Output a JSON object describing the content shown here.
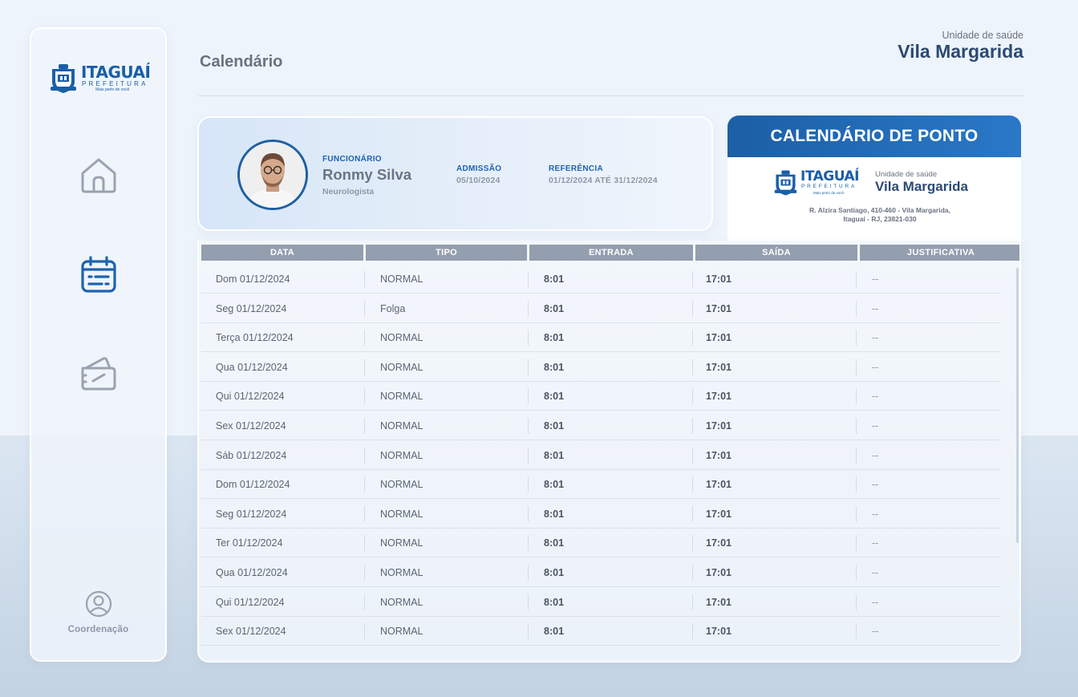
{
  "sidebar": {
    "logo": {
      "brand": "ITAGUAÍ",
      "subtitle": "PREFEITURA",
      "tagline": "Mais perto de você"
    },
    "items": [
      {
        "name": "home",
        "icon": "home-icon"
      },
      {
        "name": "calendar",
        "icon": "calendar-icon",
        "active": true
      },
      {
        "name": "ticket",
        "icon": "ticket-icon"
      }
    ],
    "user_label": "Coordenação"
  },
  "header": {
    "title": "Calendário",
    "unit_label": "Unidade de saúde",
    "unit_name": "Vila Margarida"
  },
  "employee": {
    "label": "FUNCIONÁRIO",
    "name": "Ronmy Silva",
    "role": "Neurologista",
    "admission_label": "ADMISSÃO",
    "admission": "05/10/2024",
    "reference_label": "REFERÊNCIA",
    "reference": "01/12/2024 ATÉ 31/12/2024"
  },
  "ponto_card": {
    "title": "CALENDÁRIO DE PONTO",
    "logo_brand": "ITAGUAÍ",
    "logo_subtitle": "PREFEITURA",
    "logo_tagline": "Mais perto de você",
    "unit_label": "Unidade de saúde",
    "unit_name": "Vila Margarida",
    "address_line1": "R. Alzira Santiago, 410-460 - Vila Margarida,",
    "address_line2": "Itaguaí - RJ, 23821-030"
  },
  "table": {
    "columns": [
      "DATA",
      "TIPO",
      "ENTRADA",
      "SAÍDA",
      "JUSTIFICATIVA"
    ],
    "rows": [
      {
        "data": "Dom 01/12/2024",
        "tipo": "NORMAL",
        "entrada": "8:01",
        "saida": "17:01",
        "justificativa": "--"
      },
      {
        "data": "Seg 01/12/2024",
        "tipo": "Folga",
        "entrada": "8:01",
        "saida": "17:01",
        "justificativa": "--"
      },
      {
        "data": "Terça 01/12/2024",
        "tipo": "NORMAL",
        "entrada": "8:01",
        "saida": "17:01",
        "justificativa": "--"
      },
      {
        "data": "Qua 01/12/2024",
        "tipo": "NORMAL",
        "entrada": "8:01",
        "saida": "17:01",
        "justificativa": "--"
      },
      {
        "data": "Qui 01/12/2024",
        "tipo": "NORMAL",
        "entrada": "8:01",
        "saida": "17:01",
        "justificativa": "--"
      },
      {
        "data": "Sex 01/12/2024",
        "tipo": "NORMAL",
        "entrada": "8:01",
        "saida": "17:01",
        "justificativa": "--"
      },
      {
        "data": "Sáb 01/12/2024",
        "tipo": "NORMAL",
        "entrada": "8:01",
        "saida": "17:01",
        "justificativa": "--"
      },
      {
        "data": "Dom 01/12/2024",
        "tipo": "NORMAL",
        "entrada": "8:01",
        "saida": "17:01",
        "justificativa": "--"
      },
      {
        "data": "Seg 01/12/2024",
        "tipo": "NORMAL",
        "entrada": "8:01",
        "saida": "17:01",
        "justificativa": "--"
      },
      {
        "data": "Ter 01/12/2024",
        "tipo": "NORMAL",
        "entrada": "8:01",
        "saida": "17:01",
        "justificativa": "--"
      },
      {
        "data": "Qua 01/12/2024",
        "tipo": "NORMAL",
        "entrada": "8:01",
        "saida": "17:01",
        "justificativa": "--"
      },
      {
        "data": "Qui 01/12/2024",
        "tipo": "NORMAL",
        "entrada": "8:01",
        "saida": "17:01",
        "justificativa": "--"
      },
      {
        "data": "Sex 01/12/2024",
        "tipo": "NORMAL",
        "entrada": "8:01",
        "saida": "17:01",
        "justificativa": "--"
      }
    ]
  },
  "colors": {
    "primary": "#1c5fa6",
    "heading": "#2c4a72",
    "header_cell": "#939eae"
  }
}
